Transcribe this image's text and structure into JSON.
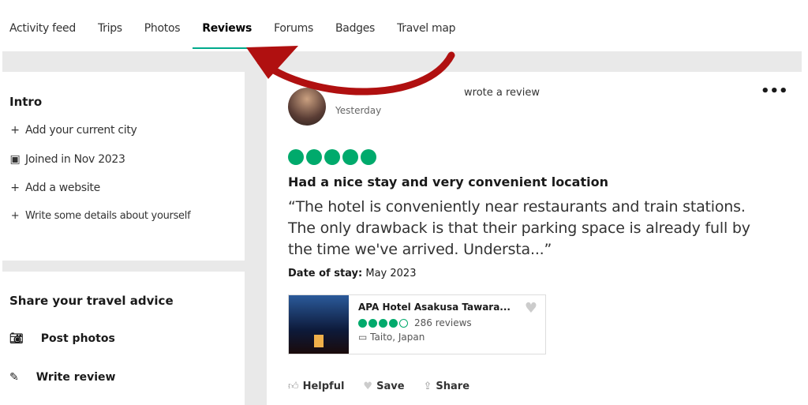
{
  "tabs": [
    {
      "label": "Activity feed"
    },
    {
      "label": "Trips"
    },
    {
      "label": "Photos"
    },
    {
      "label": "Reviews",
      "active": true
    },
    {
      "label": "Forums"
    },
    {
      "label": "Badges"
    },
    {
      "label": "Travel map"
    }
  ],
  "intro": {
    "title": "Intro",
    "items": [
      {
        "icon": "plus-icon",
        "label": "Add your current city"
      },
      {
        "icon": "calendar-icon",
        "label": "Joined in Nov 2023"
      },
      {
        "icon": "plus-icon",
        "label": "Add a website"
      },
      {
        "icon": "plus-icon",
        "label": "Write some details about yourself"
      }
    ]
  },
  "share": {
    "title": "Share your travel advice",
    "items": [
      {
        "icon": "camera-icon",
        "label": "Post photos"
      },
      {
        "icon": "edit-icon",
        "label": "Write review"
      }
    ]
  },
  "review": {
    "action": "wrote a review",
    "time": "Yesterday",
    "rating": 5,
    "title": "Had a nice stay and very convenient location",
    "body": "“The hotel is conveniently near restaurants and train stations. The only drawback is that their parking space is already full by the time we've arrived. Understa...”",
    "date_label": "Date of stay:",
    "date_value": "May 2023",
    "hotel": {
      "name": "APA Hotel Asakusa Tawara...",
      "rating": 4,
      "reviews": "286 reviews",
      "location": "Taito, Japan"
    },
    "actions": {
      "helpful": "Helpful",
      "save": "Save",
      "share": "Share"
    }
  },
  "colors": {
    "accent": "#00aa6c",
    "tab_underline": "#00aa8c",
    "arrow": "#b01010"
  }
}
